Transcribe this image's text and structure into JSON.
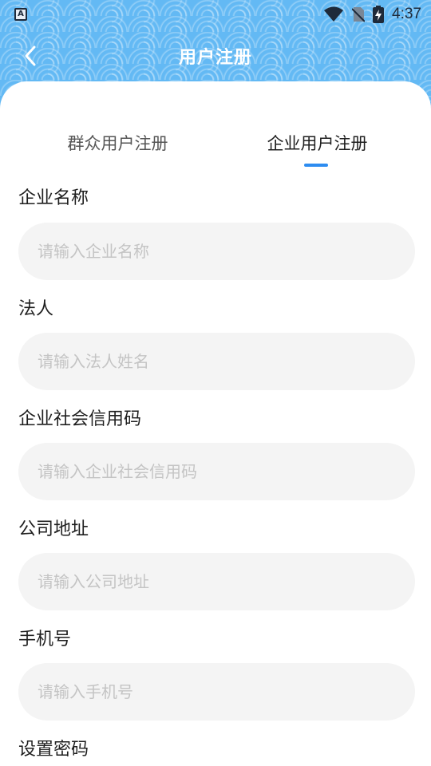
{
  "status_bar": {
    "time": "4:37",
    "icons": [
      "a-keyboard-icon",
      "wifi-icon",
      "no-sim-icon",
      "battery-charging-icon"
    ]
  },
  "nav": {
    "title": "用户注册",
    "back_icon": "chevron-left-icon"
  },
  "tabs": [
    {
      "label": "群众用户注册",
      "active": false
    },
    {
      "label": "企业用户注册",
      "active": true
    }
  ],
  "form": {
    "fields": [
      {
        "label": "企业名称",
        "placeholder": "请输入企业名称",
        "value": ""
      },
      {
        "label": "法人",
        "placeholder": "请输入法人姓名",
        "value": ""
      },
      {
        "label": "企业社会信用码",
        "placeholder": "请输入企业社会信用码",
        "value": ""
      },
      {
        "label": "公司地址",
        "placeholder": "请输入公司地址",
        "value": ""
      },
      {
        "label": "手机号",
        "placeholder": "请输入手机号",
        "value": ""
      },
      {
        "label": "设置密码"
      }
    ]
  },
  "colors": {
    "header_bg": "#63b9f4",
    "accent": "#2d8cf0",
    "input_bg": "#f4f4f4",
    "placeholder": "#c4c4c4"
  }
}
